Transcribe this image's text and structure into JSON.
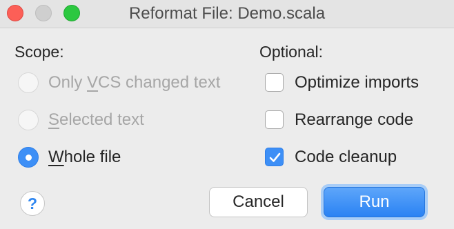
{
  "window": {
    "title": "Reformat File: Demo.scala"
  },
  "scope": {
    "label": "Scope:",
    "options": [
      {
        "pre": "Only ",
        "mnemonic": "V",
        "post": "CS changed text",
        "selected": false,
        "enabled": false
      },
      {
        "pre": "",
        "mnemonic": "S",
        "post": "elected text",
        "selected": false,
        "enabled": false
      },
      {
        "pre": "",
        "mnemonic": "W",
        "post": "hole file",
        "selected": true,
        "enabled": true
      }
    ]
  },
  "optional": {
    "label": "Optional:",
    "options": [
      {
        "label": "Optimize imports",
        "checked": false
      },
      {
        "label": "Rearrange code",
        "checked": false
      },
      {
        "label": "Code cleanup",
        "checked": true
      }
    ]
  },
  "buttons": {
    "help": "?",
    "cancel": "Cancel",
    "run": "Run"
  },
  "colors": {
    "accent": "#3d8ff6",
    "close": "#fc5f57",
    "maximize": "#2cc840",
    "disabled_text": "#a6a6a6"
  },
  "icons": {
    "help": "help-icon",
    "check": "checkmark-icon"
  }
}
